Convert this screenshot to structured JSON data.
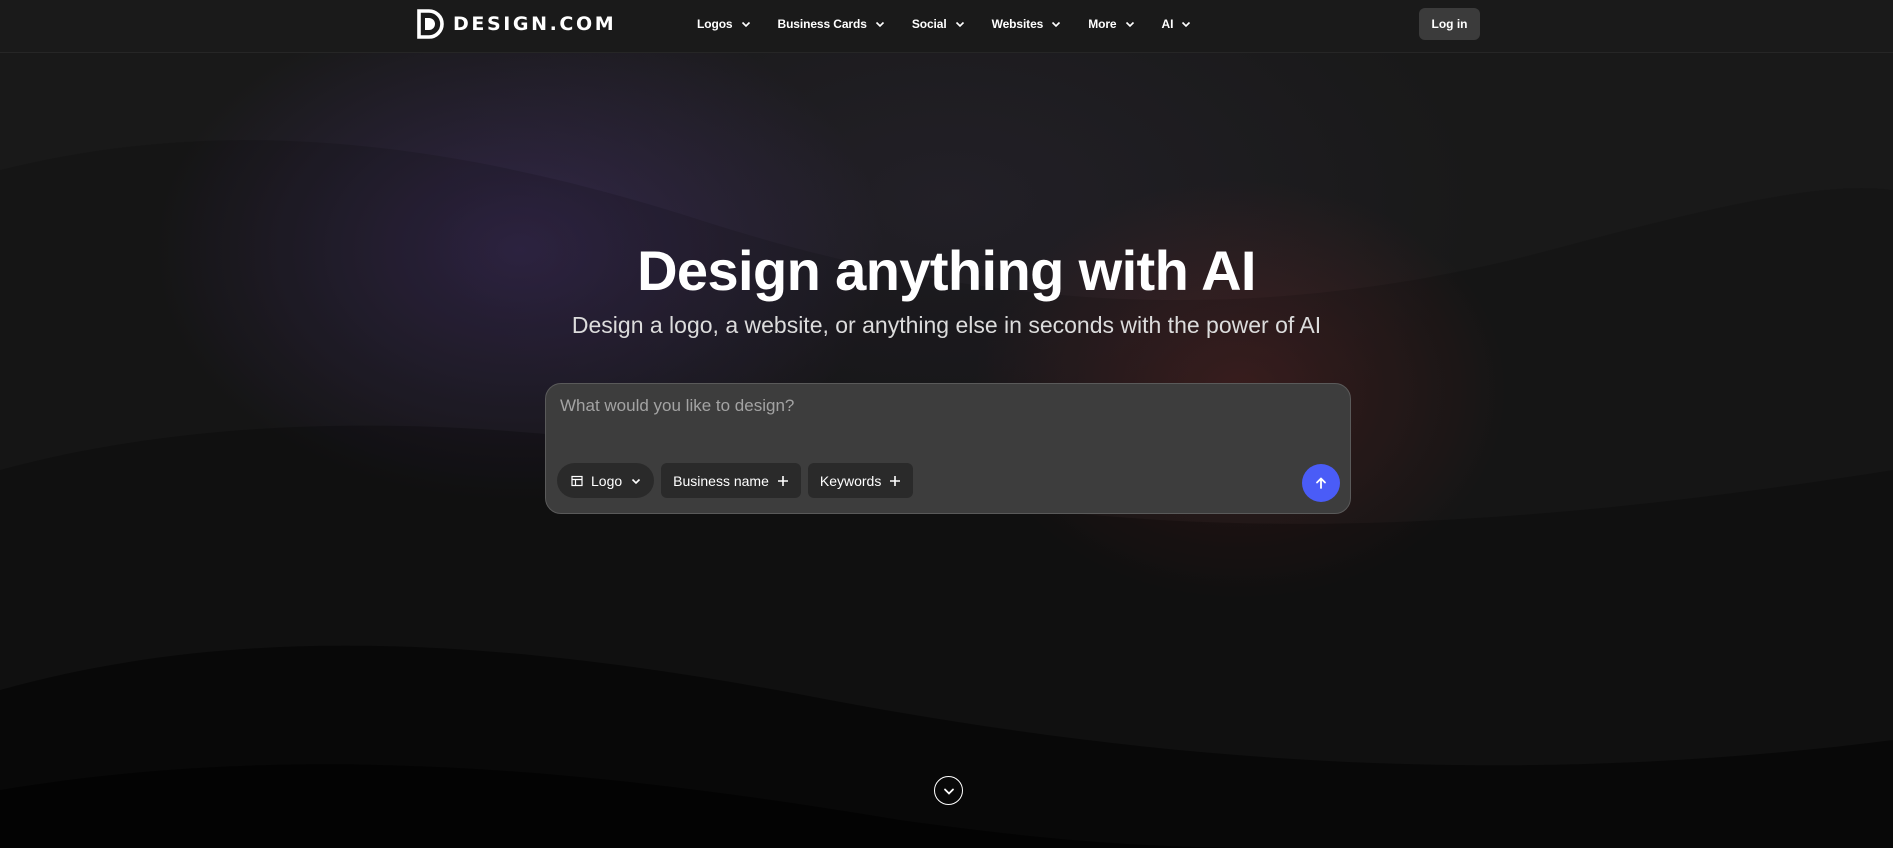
{
  "brand": {
    "name": "DESIGN.COM",
    "logo_icon": "design-d-logo-icon"
  },
  "nav": {
    "items": [
      {
        "label": "Logos",
        "icon": "chevron-down-icon"
      },
      {
        "label": "Business Cards",
        "icon": "chevron-down-icon"
      },
      {
        "label": "Social",
        "icon": "chevron-down-icon"
      },
      {
        "label": "Websites",
        "icon": "chevron-down-icon"
      },
      {
        "label": "More",
        "icon": "chevron-down-icon"
      },
      {
        "label": "AI",
        "icon": "chevron-down-icon"
      }
    ],
    "login_label": "Log in"
  },
  "hero": {
    "title": "Design anything with AI",
    "subtitle": "Design a logo, a website, or anything else in seconds with the power of AI"
  },
  "prompt": {
    "placeholder": "What would you like to design?",
    "value": "",
    "type_chip": {
      "label": "Logo",
      "icon": "layout-icon",
      "trailing_icon": "chevron-down-icon"
    },
    "chips": [
      {
        "label": "Business name",
        "icon": "plus-icon"
      },
      {
        "label": "Keywords",
        "icon": "plus-icon"
      }
    ],
    "send_icon": "arrow-up-icon"
  },
  "scroll_icon": "chevron-down-circle-icon",
  "colors": {
    "background": "#191919",
    "topbar": "#1a1a1a",
    "accent": "#4a5cf7",
    "prompt_box": "#3d3d3d",
    "chip": "#2a2a2a",
    "login_button": "#3b3b3b"
  }
}
